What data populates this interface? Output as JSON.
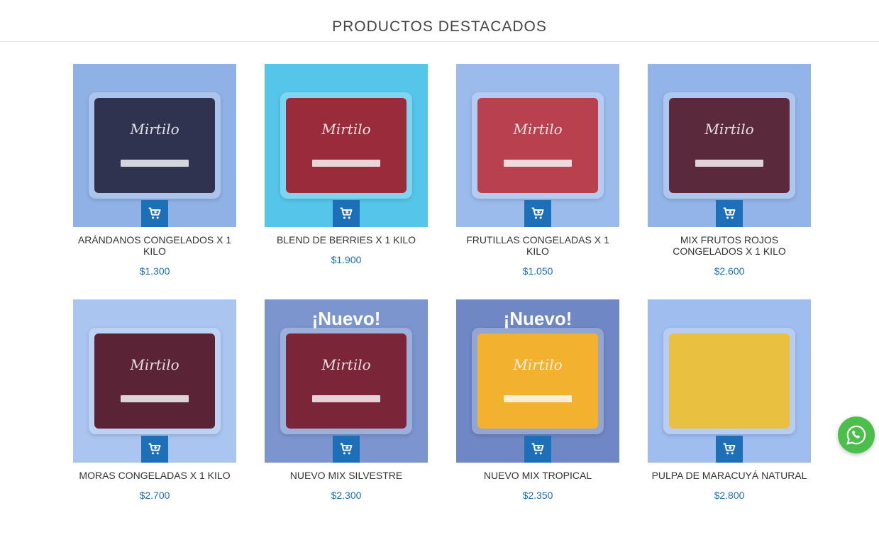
{
  "section": {
    "title": "PRODUCTOS DESTACADOS"
  },
  "colors": {
    "accent": "#1d6fb8",
    "whatsapp": "#4cbe4c"
  },
  "products": [
    {
      "name": "ARÁNDANOS CONGELADOS X 1 KILO",
      "price": "$1.300",
      "brand": "Mirtilo",
      "badge": "",
      "bg": "#8fb1e6",
      "fill": "#2f3350"
    },
    {
      "name": "BLEND DE BERRIES X 1 KILO",
      "price": "$1.900",
      "brand": "Mirtilo",
      "badge": "",
      "bg": "#55c6ea",
      "fill": "#9a2b3b"
    },
    {
      "name": "FRUTILLAS CONGELADAS X 1 KILO",
      "price": "$1.050",
      "brand": "Mirtilo",
      "badge": "",
      "bg": "#9bbbec",
      "fill": "#b8404f"
    },
    {
      "name": "MIX FRUTOS ROJOS CONGELADOS X 1 KILO",
      "price": "$2.600",
      "brand": "Mirtilo",
      "badge": "",
      "bg": "#93b4e8",
      "fill": "#5a2a3c"
    },
    {
      "name": "MORAS CONGELADAS X 1 KILO",
      "price": "$2.700",
      "brand": "Mirtilo",
      "badge": "",
      "bg": "#a9c5f0",
      "fill": "#5b2436"
    },
    {
      "name": "NUEVO MIX SILVESTRE",
      "price": "$2.300",
      "brand": "Mirtilo",
      "badge": "¡Nuevo!",
      "bg": "#7c95cf",
      "fill": "#7a2638"
    },
    {
      "name": "NUEVO MIX TROPICAL",
      "price": "$2.350",
      "brand": "Mirtilo",
      "badge": "¡Nuevo!",
      "bg": "#6f87c4",
      "fill": "#f3b130"
    },
    {
      "name": "PULPA DE MARACUYÁ NATURAL",
      "price": "$2.800",
      "brand": "",
      "badge": "",
      "bg": "#9fbdef",
      "fill": "#e9c03f"
    }
  ]
}
